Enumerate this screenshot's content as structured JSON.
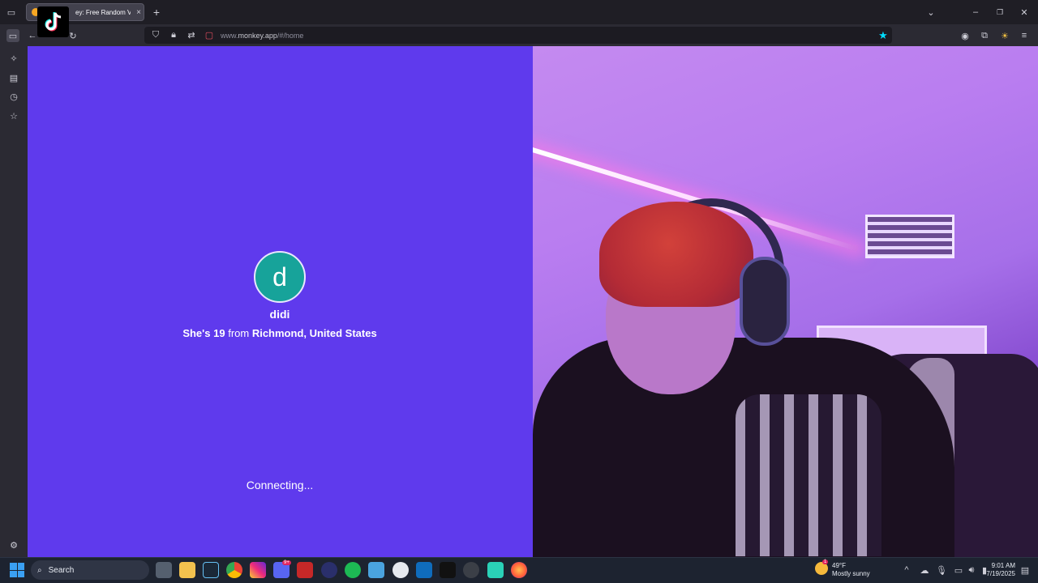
{
  "browser": {
    "tab_title": "Monkey: Free Random Video Chat",
    "tab_title_visible": "ey: Free Random Vid’",
    "url_prefix": "www.",
    "url_domain": "monkey.app",
    "url_path": "/#/home",
    "new_tab": "+"
  },
  "profile": {
    "initial": "d",
    "name": "didi",
    "pronoun": "She's",
    "age": "19",
    "from_word": "from",
    "location": "Richmond, United States"
  },
  "status": {
    "connecting": "Connecting..."
  },
  "taskbar": {
    "search_label": "Search",
    "weather_temp": "49°F",
    "weather_desc": "Mostly sunny",
    "weather_badge": "1",
    "time": "9:01 AM",
    "date": "7/19/2025",
    "discord_badge": "9+"
  },
  "colors": {
    "left_bg": "#5f3aed",
    "avatar_bg": "#17a39a",
    "accent_star": "#00ddff"
  }
}
